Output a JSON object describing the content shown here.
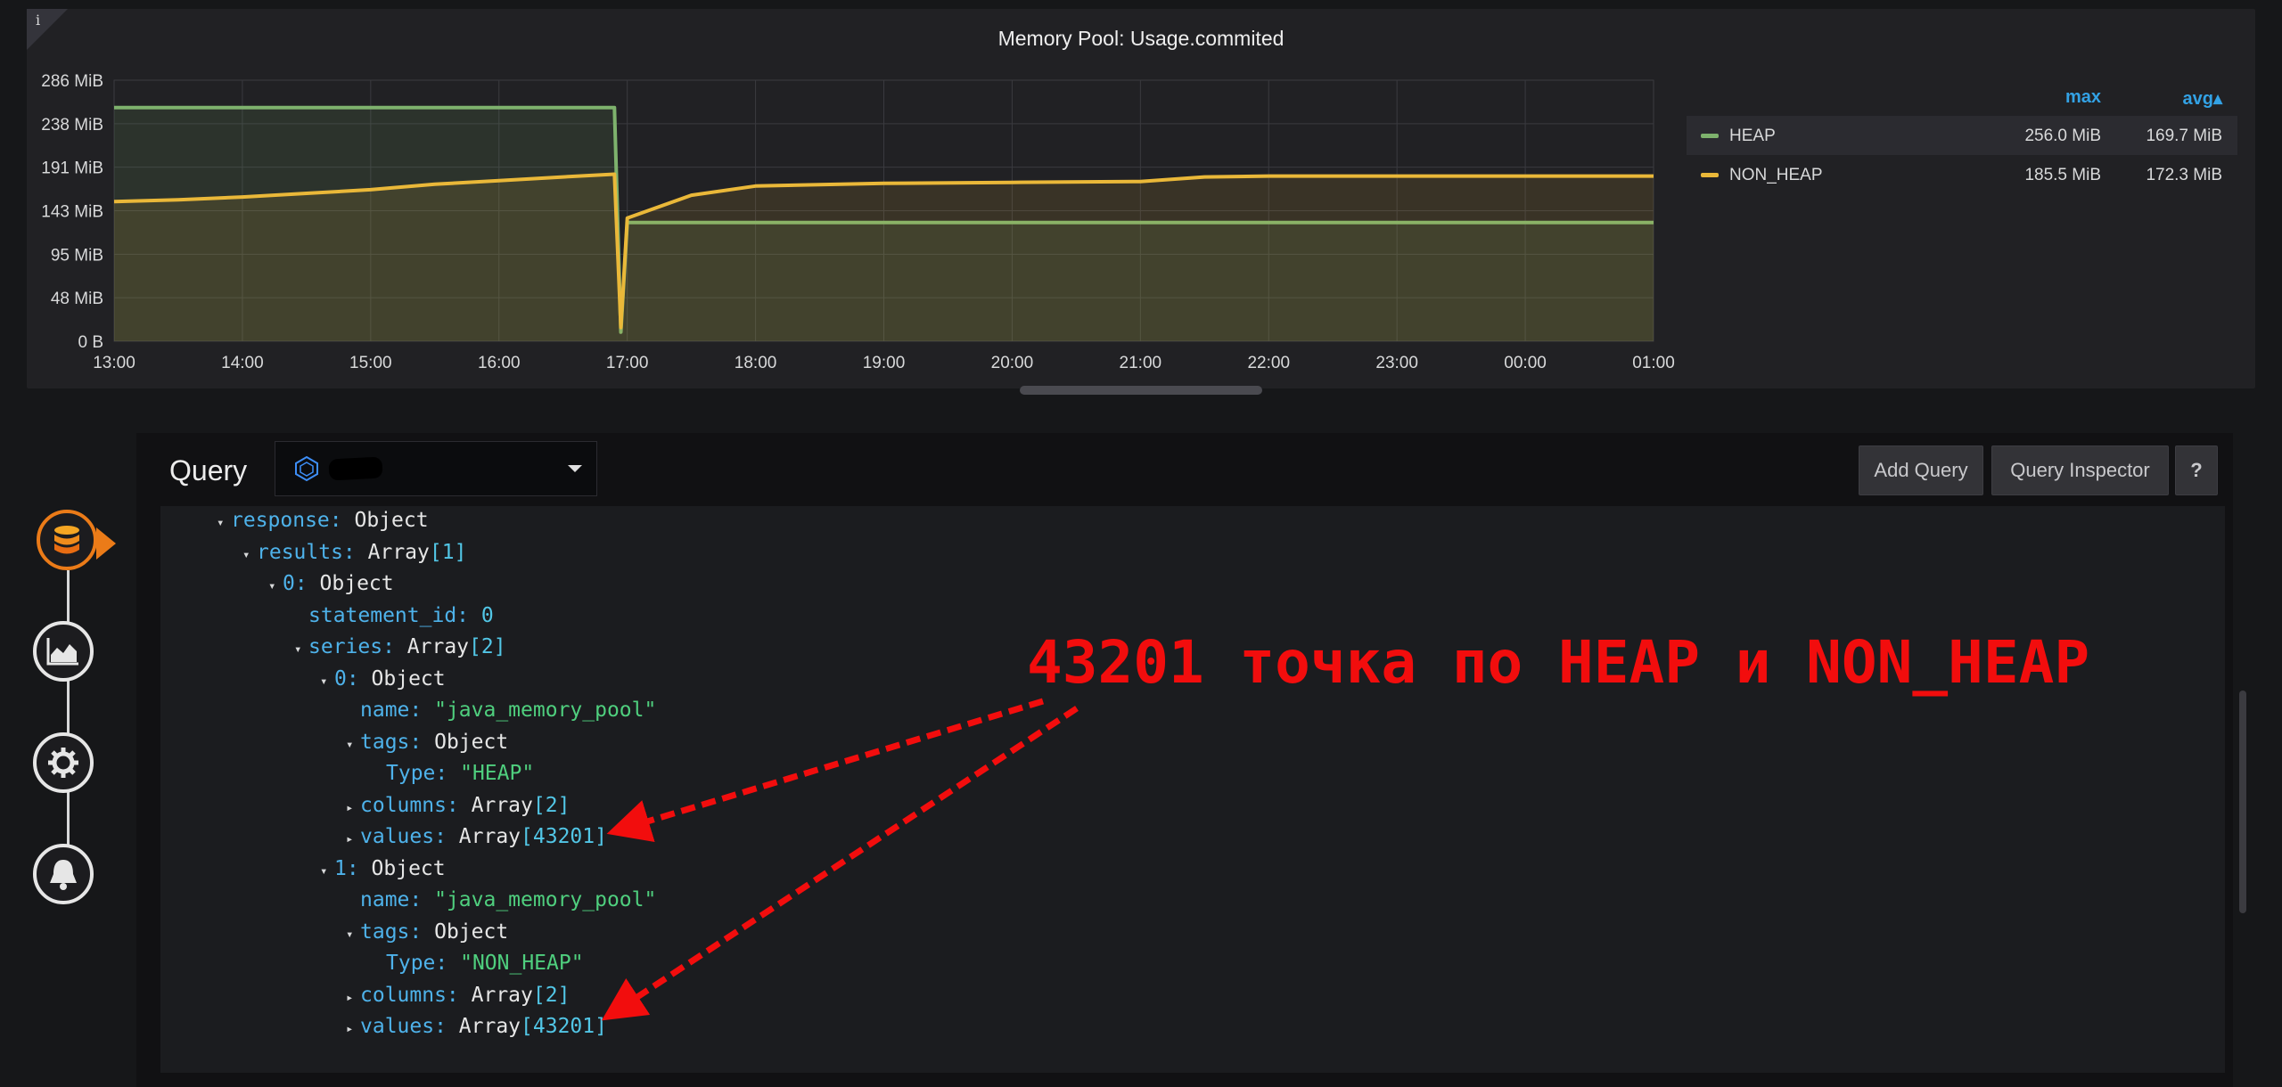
{
  "panel": {
    "title": "Memory Pool: Usage.commited",
    "info_icon": "i"
  },
  "chart_data": {
    "type": "line",
    "x_ticks": [
      "13:00",
      "14:00",
      "15:00",
      "16:00",
      "17:00",
      "18:00",
      "19:00",
      "20:00",
      "21:00",
      "22:00",
      "23:00",
      "00:00",
      "01:00"
    ],
    "y_ticks": [
      "286 MiB",
      "238 MiB",
      "191 MiB",
      "143 MiB",
      "95 MiB",
      "48 MiB",
      "0 B"
    ],
    "ylim": [
      0,
      286
    ],
    "xlim": [
      13,
      25
    ],
    "grid": true,
    "legend_position": "right",
    "series": [
      {
        "name": "HEAP",
        "color": "#7eb26d",
        "points": [
          [
            13,
            256
          ],
          [
            16.9,
            256
          ],
          [
            16.95,
            10
          ],
          [
            17.0,
            130
          ],
          [
            25,
            130
          ]
        ]
      },
      {
        "name": "NON_HEAP",
        "color": "#eab839",
        "points": [
          [
            13,
            153
          ],
          [
            13.5,
            155
          ],
          [
            14,
            158
          ],
          [
            14.5,
            162
          ],
          [
            15,
            166
          ],
          [
            15.5,
            172
          ],
          [
            16,
            176
          ],
          [
            16.5,
            180
          ],
          [
            16.9,
            183
          ],
          [
            16.95,
            15
          ],
          [
            17.0,
            135
          ],
          [
            17.5,
            160
          ],
          [
            18,
            170
          ],
          [
            19,
            173
          ],
          [
            20,
            174
          ],
          [
            21,
            175
          ],
          [
            21.5,
            180
          ],
          [
            22,
            181
          ],
          [
            23,
            181
          ],
          [
            24,
            181
          ],
          [
            25,
            181
          ]
        ]
      }
    ],
    "legend": {
      "headers": {
        "max": "max",
        "avg": "avg▴"
      },
      "rows": [
        {
          "name": "HEAP",
          "max": "256.0 MiB",
          "avg": "169.7 MiB"
        },
        {
          "name": "NON_HEAP",
          "max": "185.5 MiB",
          "avg": "172.3 MiB"
        }
      ]
    }
  },
  "query": {
    "label": "Query",
    "datasource_icon": "influxdb-icon",
    "buttons": {
      "add_query": "Add Query",
      "query_inspector": "Query Inspector",
      "help": "?"
    }
  },
  "rail_icons": [
    "database-icon",
    "chart-area-icon",
    "settings-icon",
    "bell-icon"
  ],
  "json_tree": [
    {
      "toggle": "▾",
      "key": "response:",
      "type": "Object"
    },
    {
      "toggle": "▾",
      "key": "results:",
      "type": "Array",
      "bracket": "[1]"
    },
    {
      "toggle": "▾",
      "key": "0:",
      "type": "Object"
    },
    {
      "toggle": "",
      "key": "statement_id:",
      "num": "0"
    },
    {
      "toggle": "▾",
      "key": "series:",
      "type": "Array",
      "bracket": "[2]"
    },
    {
      "toggle": "▾",
      "key": "0:",
      "type": "Object"
    },
    {
      "toggle": "",
      "key": "name:",
      "str": "\"java_memory_pool\""
    },
    {
      "toggle": "▾",
      "key": "tags:",
      "type": "Object"
    },
    {
      "toggle": "",
      "key": "Type:",
      "str": "\"HEAP\""
    },
    {
      "toggle": "▸",
      "key": "columns:",
      "type": "Array",
      "bracket": "[2]"
    },
    {
      "toggle": "▸",
      "key": "values:",
      "type": "Array",
      "bracket": "[43201]"
    },
    {
      "toggle": "▾",
      "key": "1:",
      "type": "Object"
    },
    {
      "toggle": "",
      "key": "name:",
      "str": "\"java_memory_pool\""
    },
    {
      "toggle": "▾",
      "key": "tags:",
      "type": "Object"
    },
    {
      "toggle": "",
      "key": "Type:",
      "str": "\"NON_HEAP\""
    },
    {
      "toggle": "▸",
      "key": "columns:",
      "type": "Array",
      "bracket": "[2]"
    },
    {
      "toggle": "▸",
      "key": "values:",
      "type": "Array",
      "bracket": "[43201]"
    }
  ],
  "annotation": {
    "text": "43201 точка по HEAP и NON_HEAP",
    "color": "#f20d0d"
  }
}
